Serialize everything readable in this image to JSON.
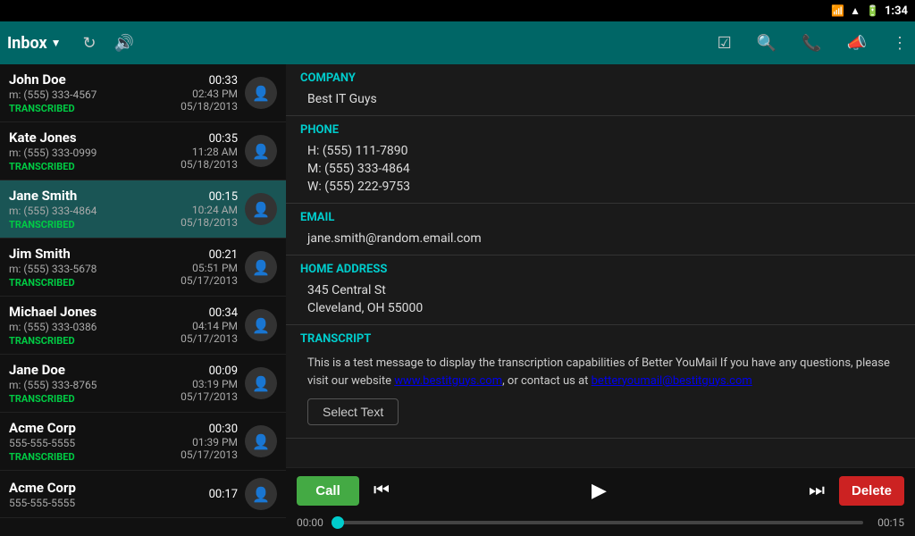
{
  "statusBar": {
    "time": "1:34",
    "icons": [
      "signal",
      "wifi",
      "battery"
    ]
  },
  "topBar": {
    "inbox_label": "Inbox",
    "refresh_icon": "↻",
    "volume_icon": "🔊",
    "nav_icons": [
      "checklist",
      "search",
      "phone-log",
      "voicemail",
      "more"
    ]
  },
  "contacts": [
    {
      "name": "John Doe",
      "number": "m: (555) 333-4567",
      "duration": "00:33",
      "time": "02:43 PM",
      "date": "05/18/2013",
      "status": "TRANSCRIBED",
      "active": false
    },
    {
      "name": "Kate Jones",
      "number": "m: (555) 333-0999",
      "duration": "00:35",
      "time": "11:28 AM",
      "date": "05/18/2013",
      "status": "TRANSCRIBED",
      "active": false
    },
    {
      "name": "Jane Smith",
      "number": "m: (555) 333-4864",
      "duration": "00:15",
      "time": "10:24 AM",
      "date": "05/18/2013",
      "status": "TRANSCRIBED",
      "active": true
    },
    {
      "name": "Jim Smith",
      "number": "m: (555) 333-5678",
      "duration": "00:21",
      "time": "05:51 PM",
      "date": "05/17/2013",
      "status": "TRANSCRIBED",
      "active": false
    },
    {
      "name": "Michael Jones",
      "number": "m: (555) 333-0386",
      "duration": "00:34",
      "time": "04:14 PM",
      "date": "05/17/2013",
      "status": "TRANSCRIBED",
      "active": false
    },
    {
      "name": "Jane Doe",
      "number": "m: (555) 333-8765",
      "duration": "00:09",
      "time": "03:19 PM",
      "date": "05/17/2013",
      "status": "TRANSCRIBED",
      "active": false
    },
    {
      "name": "Acme Corp",
      "number": "555-555-5555",
      "duration": "00:30",
      "time": "01:39 PM",
      "date": "05/17/2013",
      "status": "TRANSCRIBED",
      "active": false
    },
    {
      "name": "Acme Corp",
      "number": "555-555-5555",
      "duration": "00:17",
      "time": "",
      "date": "",
      "status": "",
      "active": false
    }
  ],
  "detail": {
    "company_header": "COMPANY",
    "company_value": "Best IT Guys",
    "phone_header": "PHONE",
    "phone_h": "H: (555) 111-7890",
    "phone_m": "M: (555) 333-4864",
    "phone_w": "W: (555) 222-9753",
    "email_header": "EMAIL",
    "email_value": "jane.smith@random.email.com",
    "address_header": "HOME ADDRESS",
    "address_line1": "345 Central St",
    "address_line2": "Cleveland, OH 55000",
    "transcript_header": "TRANSCRIPT",
    "transcript_text": "This is a test message to display the transcription capabilities of Better YouMail\nIf you have any questions, please visit our website www.bestitguys.com, or contact us at\nbetteryoumail@bestitguys.com",
    "transcript_link1": "www.bestitguys.com",
    "transcript_link2": "betteryoumail@bestitguys.com",
    "select_text_label": "Select Text"
  },
  "player": {
    "call_label": "Call",
    "delete_label": "Delete",
    "time_start": "00:00",
    "time_end": "00:15",
    "progress_percent": 0
  }
}
